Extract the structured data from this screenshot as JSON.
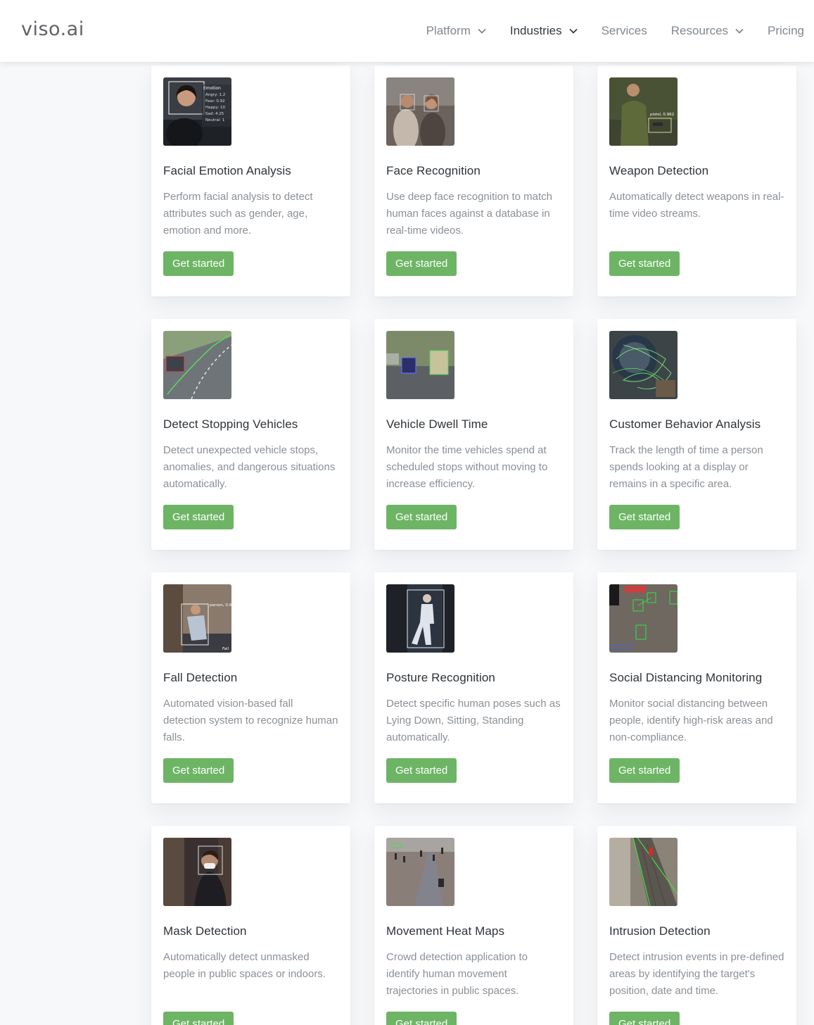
{
  "header": {
    "logo": "viso.ai",
    "nav": [
      {
        "label": "Platform",
        "dropdown": true,
        "active": false
      },
      {
        "label": "Industries",
        "dropdown": true,
        "active": true
      },
      {
        "label": "Services",
        "dropdown": false,
        "active": false
      },
      {
        "label": "Resources",
        "dropdown": true,
        "active": false
      },
      {
        "label": "Pricing",
        "dropdown": false,
        "active": false
      }
    ]
  },
  "colors": {
    "accent_green": "#6db565",
    "page_bg": "#f7f8fa",
    "title_text": "#2e3338",
    "body_text": "#8a9096"
  },
  "cards": [
    {
      "title": "Facial Emotion Analysis",
      "desc": "Perform facial analysis to detect attributes such as gender, age, emotion and more.",
      "button": "Get started",
      "image": "facial-emotion-thumbnail"
    },
    {
      "title": "Face Recognition",
      "desc": "Use deep face recognition to match human faces against a database in real-time videos.",
      "button": "Get started",
      "image": "face-recognition-thumbnail"
    },
    {
      "title": "Weapon Detection",
      "desc": "Automatically detect weapons in real-time video streams.",
      "button": "Get started",
      "image": "weapon-detection-thumbnail"
    },
    {
      "title": "Detect Stopping Vehicles",
      "desc": "Detect unexpected vehicle stops, anomalies, and dangerous situations automatically.",
      "button": "Get started",
      "image": "stopping-vehicles-thumbnail"
    },
    {
      "title": "Vehicle Dwell Time",
      "desc": "Monitor the time vehicles spend at scheduled stops without moving to increase efficiency.",
      "button": "Get started",
      "image": "vehicle-dwell-thumbnail"
    },
    {
      "title": "Customer Behavior Analysis",
      "desc": "Track the length of time a person spends looking at a display or remains in a specific area.",
      "button": "Get started",
      "image": "customer-behavior-thumbnail"
    },
    {
      "title": "Fall Detection",
      "desc": "Automated vision-based fall detection system to recognize human falls.",
      "button": "Get started",
      "image": "fall-detection-thumbnail"
    },
    {
      "title": "Posture Recognition",
      "desc": "Detect specific human poses such as Lying Down, Sitting, Standing automatically.",
      "button": "Get started",
      "image": "posture-recognition-thumbnail"
    },
    {
      "title": "Social Distancing Monitoring",
      "desc": "Monitor social distancing between people, identify high-risk areas and non-compliance.",
      "button": "Get started",
      "image": "social-distancing-thumbnail"
    },
    {
      "title": "Mask Detection",
      "desc": "Automatically detect unmasked people in public spaces or indoors.",
      "button": "Get started",
      "image": "mask-detection-thumbnail"
    },
    {
      "title": "Movement Heat Maps",
      "desc": "Crowd detection application to identify human movement trajectories in public spaces.",
      "button": "Get started",
      "image": "heat-maps-thumbnail"
    },
    {
      "title": "Intrusion Detection",
      "desc": "Detect intrusion events in pre-defined areas by identifying the target's position, date and time.",
      "button": "Get started",
      "image": "intrusion-detection-thumbnail"
    }
  ]
}
